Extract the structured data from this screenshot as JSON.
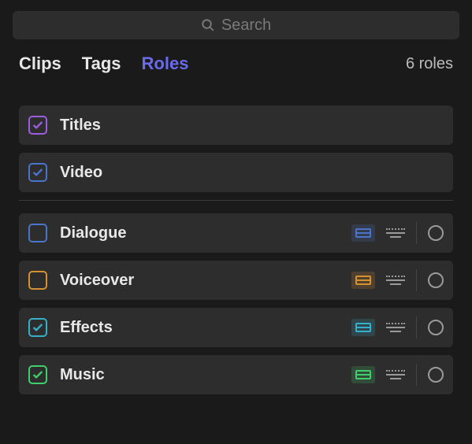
{
  "search": {
    "placeholder": "Search"
  },
  "tabs": {
    "clips": "Clips",
    "tags": "Tags",
    "roles": "Roles",
    "active": "roles"
  },
  "roles_count_label": "6 roles",
  "colors": {
    "titles": "#9d5de0",
    "video": "#4a74c9",
    "dialogue": "#4a74c9",
    "voiceover": "#d6902f",
    "effects": "#36b0c9",
    "music": "#3fce6b"
  },
  "video_roles": [
    {
      "id": "titles",
      "label": "Titles",
      "checked": true
    },
    {
      "id": "video",
      "label": "Video",
      "checked": true
    }
  ],
  "audio_roles": [
    {
      "id": "dialogue",
      "label": "Dialogue",
      "checked": false
    },
    {
      "id": "voiceover",
      "label": "Voiceover",
      "checked": false
    },
    {
      "id": "effects",
      "label": "Effects",
      "checked": true
    },
    {
      "id": "music",
      "label": "Music",
      "checked": true
    }
  ]
}
